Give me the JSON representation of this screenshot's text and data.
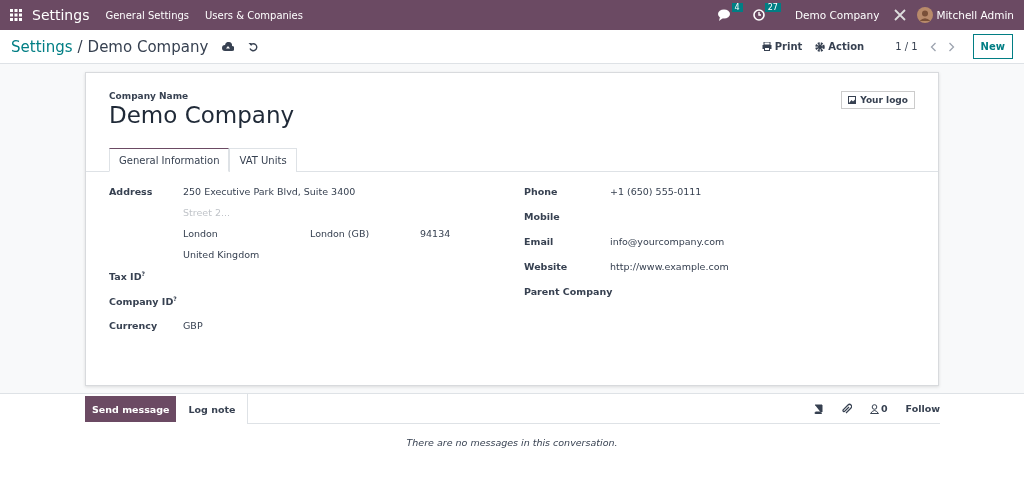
{
  "navbar": {
    "app_name": "Settings",
    "menus": [
      "General Settings",
      "Users & Companies"
    ],
    "messages_count": "4",
    "activities_count": "27",
    "company": "Demo Company",
    "user": "Mitchell Admin"
  },
  "control_panel": {
    "breadcrumb_parent": "Settings",
    "breadcrumb_separator": "/",
    "breadcrumb_current": "Demo Company",
    "print": "Print",
    "action": "Action",
    "pager": "1 / 1",
    "new": "New"
  },
  "form": {
    "name_label": "Company Name",
    "name": "Demo Company",
    "logo_button": "Your logo",
    "tabs": [
      {
        "label": "General Information",
        "selected": true
      },
      {
        "label": "VAT Units",
        "selected": false
      }
    ],
    "address": {
      "label": "Address",
      "street": "250 Executive Park Blvd, Suite 3400",
      "street2_placeholder": "Street 2...",
      "city": "London",
      "state": "London (GB)",
      "zip": "94134",
      "country": "United Kingdom"
    },
    "left_fields": [
      {
        "label": "Tax ID$^{?}$"
      },
      {
        "label": "Company ID$^{?}$"
      },
      {
        "label": "Currency",
        "value": "GBP"
      }
    ],
    "right_fields": [
      {
        "label": "Phone",
        "value": "+1 (650) 555-0111"
      },
      {
        "label": "Mobile"
      },
      {
        "label": "Email",
        "value": "info@yourcompany.com"
      },
      {
        "label": "Website",
        "value": "http://www.example.com"
      },
      {
        "label": "Parent Company"
      }
    ]
  },
  "chatter": {
    "send_message": "Send message",
    "log_note": "Log note",
    "followers_count": "0",
    "follow": "Follow",
    "empty": "There are no messages in this conversation."
  }
}
